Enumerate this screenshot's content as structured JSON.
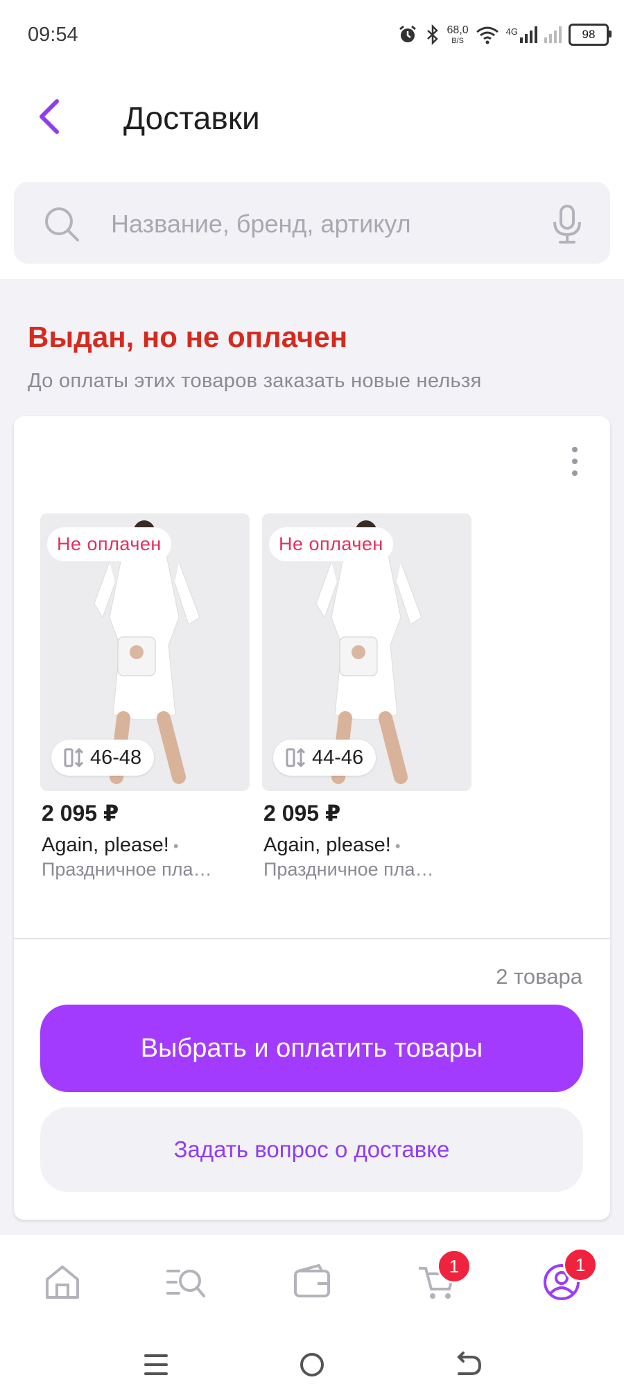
{
  "status_bar": {
    "time": "09:54",
    "speed_value": "68,0",
    "speed_unit": "B/S",
    "network": "4G",
    "battery": "98"
  },
  "header": {
    "title": "Доставки"
  },
  "search": {
    "placeholder": "Название, бренд, артикул"
  },
  "alert": {
    "title": "Выдан, но не оплачен",
    "subtitle": "До оплаты этих товаров заказать новые нельзя"
  },
  "products": [
    {
      "badge": "Не оплачен",
      "size": "46-48",
      "price": "2 095 ₽",
      "brand": "Again, please!",
      "name": "Праздничное пла…"
    },
    {
      "badge": "Не оплачен",
      "size": "44-46",
      "price": "2 095 ₽",
      "brand": "Again, please!",
      "name": "Праздничное пла…"
    }
  ],
  "card": {
    "items_count": "2 товара",
    "pay_button": "Выбрать и оплатить товары",
    "ask_button": "Задать вопрос о доставке"
  },
  "bottom_nav": {
    "cart_badge": "1",
    "profile_badge": "1"
  },
  "colors": {
    "accent": "#a33bff",
    "alert": "#d52b1e",
    "badge": "#f0223d",
    "unpaid": "#e1305d"
  },
  "icons": {
    "back": "chevron-left-icon",
    "search": "search-icon",
    "mic": "microphone-icon",
    "home": "home-icon",
    "catalog": "catalog-search-icon",
    "wallet": "wallet-icon",
    "cart": "cart-icon",
    "profile": "profile-icon"
  }
}
